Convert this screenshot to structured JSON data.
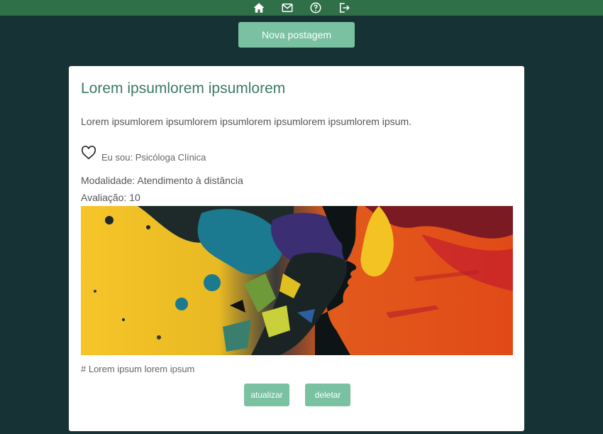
{
  "nav": {
    "icons": [
      "home-icon",
      "mail-icon",
      "help-icon",
      "logout-icon"
    ]
  },
  "new_post": {
    "label": "Nova postagem"
  },
  "post": {
    "title": "Lorem ipsumlorem ipsumlorem",
    "text": "Lorem ipsumlorem ipsumlorem ipsumlorem ipsumlorem ipsumlorem ipsum.",
    "role": "Eu sou: Psicóloga Clínica",
    "modalidade": "Modalidade: Atendimento à distância",
    "avaliacao": "Avaliação: 10",
    "tags": "# Lorem ipsum lorem ipsum",
    "actions": {
      "update_label": "atualizar",
      "delete_label": "deletar"
    }
  },
  "colors": {
    "background": "#163234",
    "topbar": "#2f7048",
    "accent_button": "#79c1a1",
    "title": "#3b7a64"
  }
}
